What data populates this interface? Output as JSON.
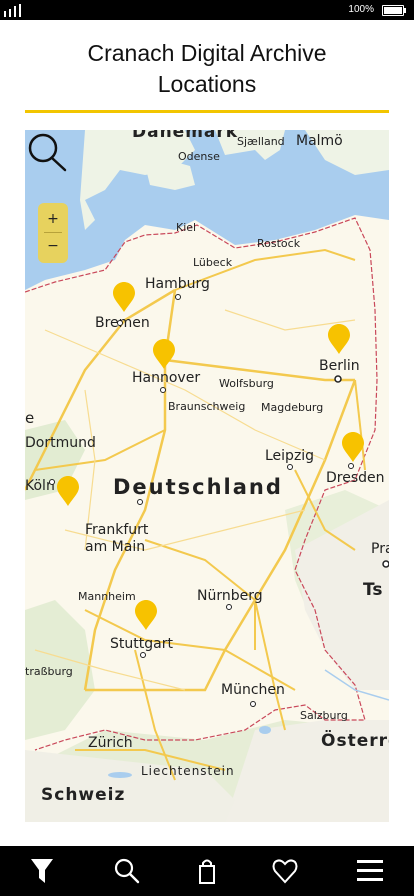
{
  "status_bar": {
    "battery": "100%"
  },
  "page": {
    "title_line1": "Cranach Digital Archive",
    "title_line2": "Locations"
  },
  "map": {
    "zoom_in": "+",
    "zoom_out": "−",
    "country_label": "Deutschland",
    "labels": [
      {
        "text": "Danemark"
      },
      {
        "text": "Sjælland"
      },
      {
        "text": "Malmö"
      },
      {
        "text": "Odense"
      },
      {
        "text": "Kiel"
      },
      {
        "text": "Rostock"
      },
      {
        "text": "Lübeck"
      },
      {
        "text": "Hamburg"
      },
      {
        "text": "Bremen"
      },
      {
        "text": "Berlin"
      },
      {
        "text": "Hannover"
      },
      {
        "text": "Wolfsburg"
      },
      {
        "text": "Braunschweig"
      },
      {
        "text": "Magdeburg"
      },
      {
        "text": "e"
      },
      {
        "text": "Dortmund"
      },
      {
        "text": "Leipzig"
      },
      {
        "text": "Dresden"
      },
      {
        "text": "Köln"
      },
      {
        "text": "Frankfurt"
      },
      {
        "text": "am Main"
      },
      {
        "text": "Pra"
      },
      {
        "text": "Ts"
      },
      {
        "text": "Mannheim"
      },
      {
        "text": "Nürnberg"
      },
      {
        "text": "Stuttgart"
      },
      {
        "text": "traßburg"
      },
      {
        "text": "München"
      },
      {
        "text": "Salzburg"
      },
      {
        "text": "Zürich"
      },
      {
        "text": "Österre"
      },
      {
        "text": "Liechtenstein"
      },
      {
        "text": "Schweiz"
      }
    ],
    "pin_color": "#f7c200"
  },
  "nav": [
    "filter-icon",
    "search-icon",
    "bag-icon",
    "heart-icon",
    "menu-icon"
  ]
}
